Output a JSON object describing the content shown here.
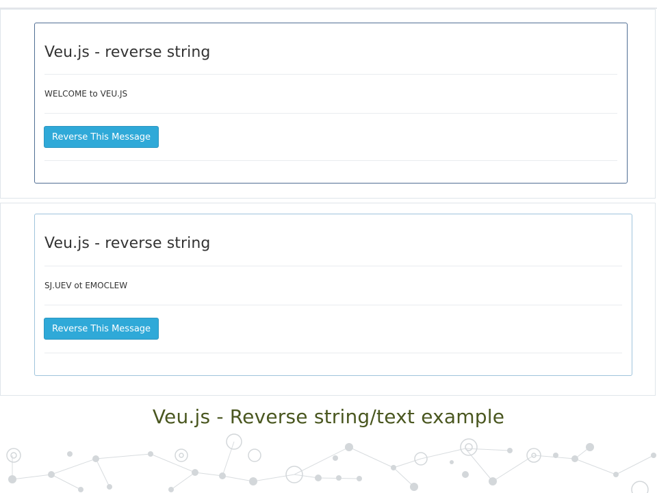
{
  "screens": [
    {
      "title": "Veu.js - reverse string",
      "message": "WELCOME to VEU.JS",
      "button_label": "Reverse This Message"
    },
    {
      "title": "Veu.js - reverse string",
      "message": "SJ.UEV ot EMOCLEW",
      "button_label": "Reverse This Message"
    }
  ],
  "caption": "Veu.js - Reverse string/text example",
  "colors": {
    "button": "#2fa9d8",
    "caption": "#4a5720",
    "decor": "#cfd3d6"
  }
}
